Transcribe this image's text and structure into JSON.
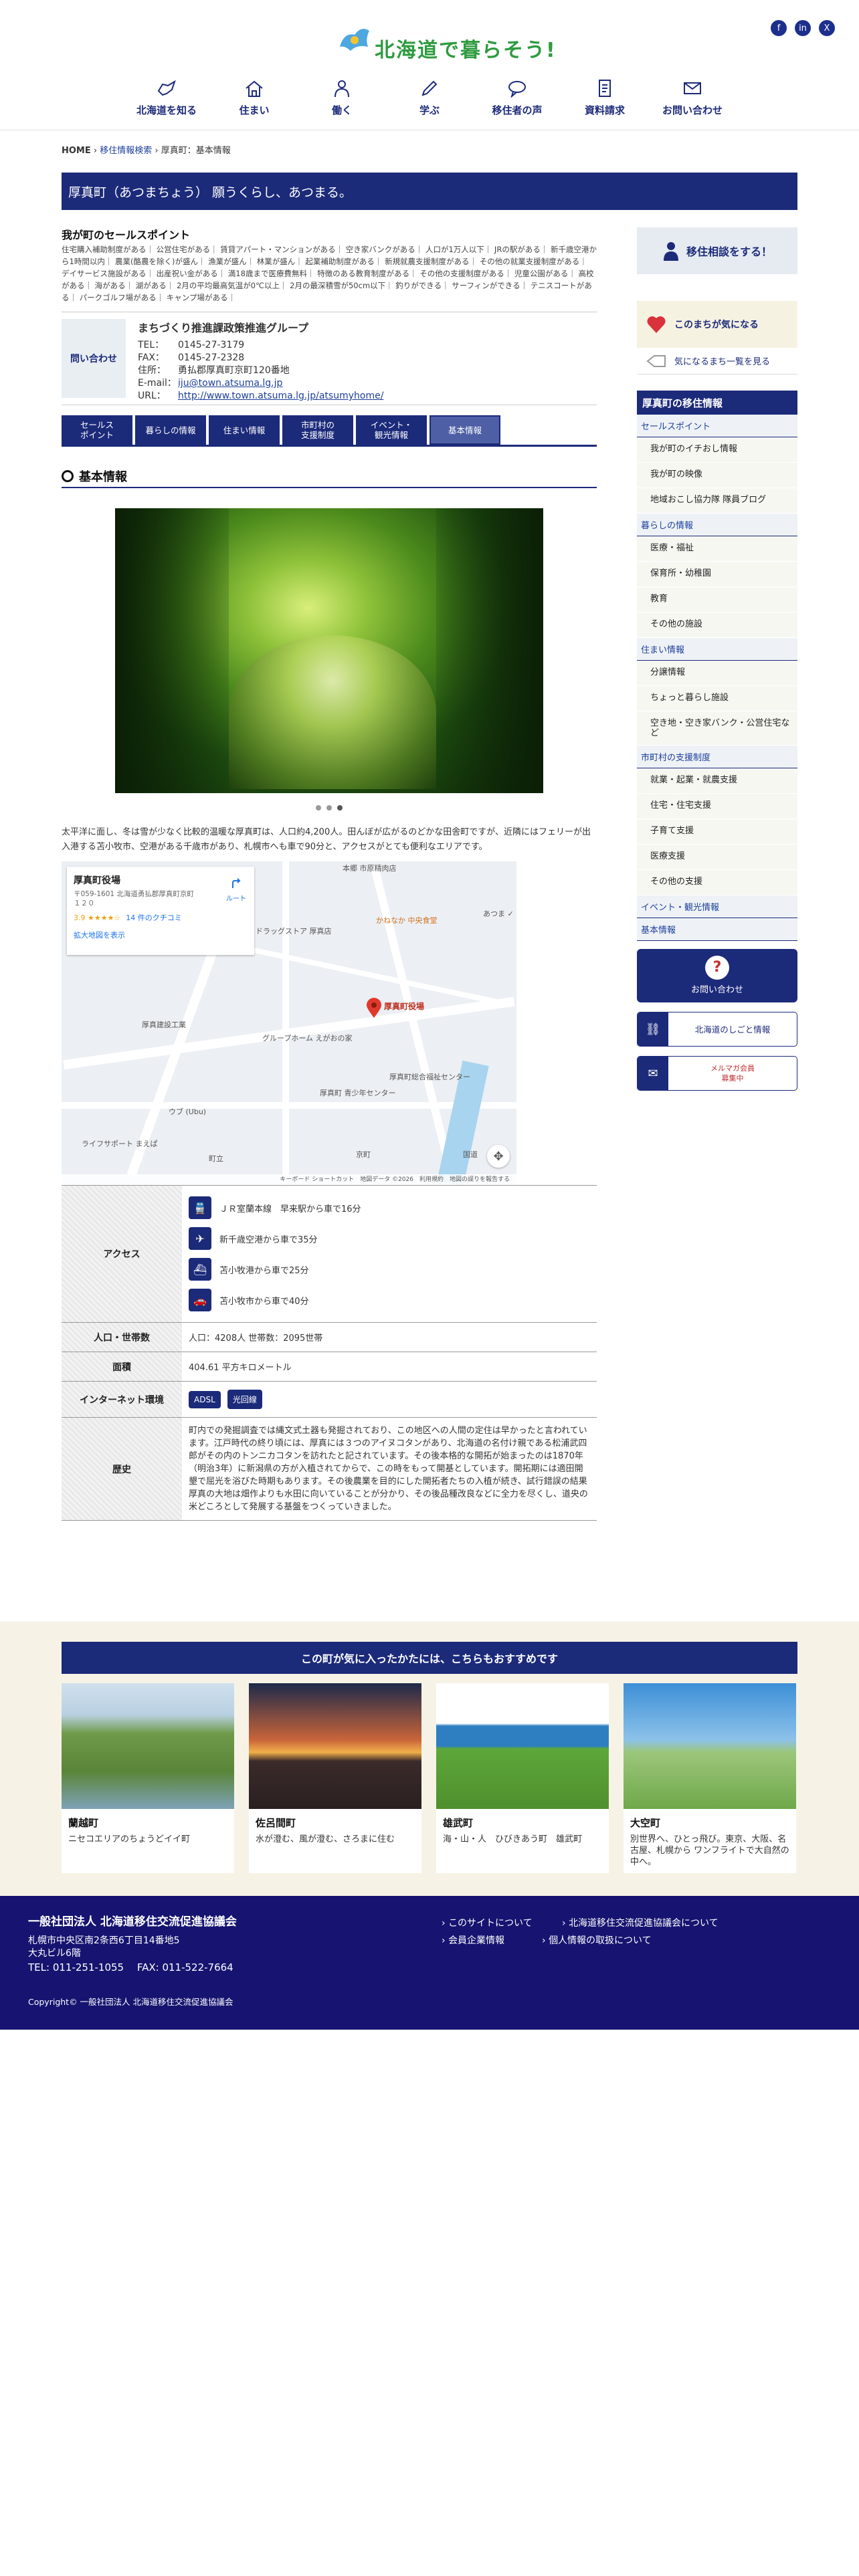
{
  "header": {
    "logo_text": "北海道で暮らそう!",
    "sns": [
      "f",
      "in",
      "X"
    ],
    "nav": [
      {
        "label": "北海道を知る",
        "icon": "hokkaido-map-icon"
      },
      {
        "label": "住まい",
        "icon": "house-icon"
      },
      {
        "label": "働く",
        "icon": "worker-icon"
      },
      {
        "label": "学ぶ",
        "icon": "pen-icon"
      },
      {
        "label": "移住者の声",
        "icon": "speech-bubble-icon"
      },
      {
        "label": "資料請求",
        "icon": "document-icon"
      },
      {
        "label": "お問い合わせ",
        "icon": "mail-icon"
      }
    ]
  },
  "breadcrumb": {
    "home": "HOME",
    "sep": "›",
    "parent": "移住情報検索",
    "current": "厚真町：基本情報"
  },
  "page_title": "厚真町（あつまちょう） 願うくらし、あつまる。",
  "selling_points": {
    "title": "我が町のセールスポイント",
    "text": "住宅購入補助制度がある｜ 公営住宅がある｜ 賃貸アパート・マンションがある｜ 空き家バンクがある｜ 人口が1万人以下｜ JRの駅がある｜ 新千歳空港から1時間以内｜ 農業(酪農を除く)が盛ん｜ 漁業が盛ん｜ 林業が盛ん｜ 起業補助制度がある｜ 新規就農支援制度がある｜ その他の就業支援制度がある｜ デイサービス施設がある｜ 出産祝い金がある｜ 満18歳まで医療費無料｜ 特徴のある教育制度がある｜ その他の支援制度がある｜ 児童公園がある｜ 高校がある｜ 海がある｜ 湖がある｜ 2月の平均最高気温が0℃以上｜ 2月の最深積雪が50cm以下｜ 釣りができる｜ サーフィンができる｜ テニスコートがある｜ パークゴルフ場がある｜ キャンプ場がある｜"
  },
  "contact": {
    "label": "問い合わせ",
    "org": "まちづくり推進課政策推進グループ",
    "rows": [
      {
        "k": "TEL：",
        "v": "0145-27-3179"
      },
      {
        "k": "FAX：",
        "v": "0145-27-2328"
      },
      {
        "k": "住所：",
        "v": "勇払郡厚真町京町120番地"
      },
      {
        "k": "E-mail：",
        "v": "iju@town.atsuma.lg.jp"
      },
      {
        "k": "URL：",
        "v": "http://www.town.atsuma.lg.jp/atsumyhome/"
      }
    ]
  },
  "tabs": [
    "セールス\nポイント",
    "暮らしの情報",
    "住まい情報",
    "市町村の\n支援制度",
    "イベント・\n観光情報",
    "基本情報"
  ],
  "section_title": "基本情報",
  "intro": "太平洋に面し、冬は雪が少なく比較的温暖な厚真町は、人口約4,200人。田んぼが広がるのどかな田舎町ですが、近隣にはフェリーが出入港する苫小牧市、空港がある千歳市があり、札幌市へも車で90分と、アクセスがとても便利なエリアです。",
  "map": {
    "place": "厚真町役場",
    "address": "〒059-1601 北海道勇払郡厚真町京町１２０",
    "rating": "3.9 ★★★★☆",
    "reviews": "14 件のクチコミ",
    "enlarge": "拡大地図を表示",
    "route": "ルート",
    "pin_label": "厚真町役場",
    "labels": [
      "本郷 市原精肉店",
      "ドラッグストア 厚真店",
      "かねなか 中央食堂",
      "厚真建設工業",
      "グループホーム えがおの家",
      "厚真町総合福祉センター",
      "厚真町 青少年センター",
      "ウブ (Ubu)",
      "ライフサポート まえぱ",
      "あつま ✓",
      "町立",
      "国道",
      "京町"
    ],
    "footer": "キーボード ショートカット　地図データ ©2026　利用規約　地図の誤りを報告する"
  },
  "table": {
    "access_label": "アクセス",
    "access": [
      {
        "icon": "train-icon",
        "glyph": "🚆",
        "text": "ＪＲ室蘭本線　早来駅から車で16分"
      },
      {
        "icon": "airplane-icon",
        "glyph": "✈",
        "text": "新千歳空港から車で35分"
      },
      {
        "icon": "ship-icon",
        "glyph": "⛴",
        "text": "苫小牧港から車で25分"
      },
      {
        "icon": "car-icon",
        "glyph": "🚗",
        "text": "苫小牧市から車で40分"
      }
    ],
    "population_label": "人口・世帯数",
    "population": "人口：4208人 世帯数：2095世帯",
    "area_label": "面積",
    "area": "404.61 平方キロメートル",
    "net_label": "インターネット環境",
    "net": [
      "ADSL",
      "光回線"
    ],
    "history_label": "歴史",
    "history": "町内での発掘調査では縄文式土器も発掘されており、この地区への人間の定住は早かったと言われています。江戸時代の終り頃には、厚真には３つのアイヌコタンがあり、北海道の名付け親である松浦武四郎がその内のトンニカコタンを訪れたと記されています。その後本格的な開拓が始まったのは1870年（明治3年）に新潟県の方が入植されてからで、この時をもって開基としています。開拓期には適田開墾で屈光を浴びた時期もあります。その後農業を目的にした開拓者たちの入植が続き、試行錯誤の結果厚真の大地は畑作よりも水田に向いていることが分かり、その後品種改良などに全力を尽くし、道央の米どころとして発展する基盤をつくっていきました。"
  },
  "sidebar": {
    "consult": "移住相談をする！",
    "fav": "このまちが気になる",
    "fav_list": "気になるまち一覧を見る",
    "menu_head": "厚真町の移住情報",
    "menu": [
      {
        "cat": "セールスポイント",
        "items": [
          "我が町のイチおし情報",
          "我が町の映像",
          "地域おこし協力隊 隊員ブログ"
        ]
      },
      {
        "cat": "暮らしの情報",
        "items": [
          "医療・福祉",
          "保育所・幼稚園",
          "教育",
          "その他の施設"
        ]
      },
      {
        "cat": "住まい情報",
        "items": [
          "分譲情報",
          "ちょっと暮らし施設",
          "空き地・空き家バンク・公営住宅など"
        ]
      },
      {
        "cat": "市町村の支援制度",
        "items": [
          "就業・起業・就農支援",
          "住宅・住宅支援",
          "子育て支援",
          "医療支援",
          "その他の支援"
        ]
      },
      {
        "cat": "イベント・観光情報",
        "items": []
      },
      {
        "cat": "基本情報",
        "items": []
      }
    ],
    "btn_contact": "お問い合わせ",
    "btn_job": "北海道のしごと情報",
    "btn_mail": "メルマガ会員\n募集中"
  },
  "recommend": {
    "head": "この町が気に入ったかたには、こちらもおすすめです",
    "cards": [
      {
        "name": "蘭越町",
        "desc": "ニセコエリアのちょうどイイ町"
      },
      {
        "name": "佐呂間町",
        "desc": "水が澄む、風が澄む、さろまに住む"
      },
      {
        "name": "雄武町",
        "desc": "海・山・人　ひびきあう町　雄武町"
      },
      {
        "name": "大空町",
        "desc": "別世界へ、ひとっ飛び。東京、大阪、名古屋、札幌から ワンフライトで大自然の中へ。"
      }
    ]
  },
  "footer": {
    "org": "一般社団法人 北海道移住交流促進協議会",
    "addr": "札幌市中央区南2条西6丁目14番地5\n大丸ビル6階",
    "tel": "TEL: 011-251-1055　 FAX: 011-522-7664",
    "links": [
      "このサイトについて",
      "北海道移住交流促進協議会について",
      "会員企業情報",
      "個人情報の取扱について"
    ],
    "copyright": "Copyright© 一般社団法人 北海道移住交流促進協議会"
  }
}
